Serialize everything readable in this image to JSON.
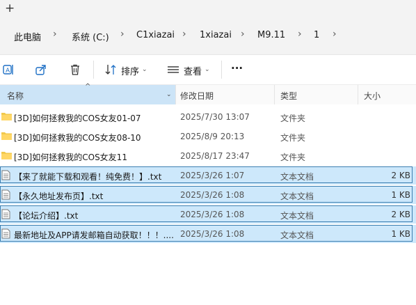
{
  "tabstrip": {
    "new_tab_glyph": "+"
  },
  "breadcrumb": [
    {
      "label": "此电脑"
    },
    {
      "label": "系统 (C:)"
    },
    {
      "label": "C1xiazai"
    },
    {
      "label": "1xiazai"
    },
    {
      "label": "M9.11"
    },
    {
      "label": "1"
    }
  ],
  "toolbar": {
    "sort_label": "排序",
    "view_label": "查看",
    "more_glyph": "···"
  },
  "columns": {
    "name": "名称",
    "date": "修改日期",
    "type": "类型",
    "size": "大小"
  },
  "files": [
    {
      "name": "[3D]如何拯救我的COS女友01-07",
      "date": "2025/7/30 13:07",
      "type": "文件夹",
      "size": "",
      "kind": "folder",
      "selected": false
    },
    {
      "name": "[3D]如何拯救我的COS女友08-10",
      "date": "2025/8/9 20:13",
      "type": "文件夹",
      "size": "",
      "kind": "folder",
      "selected": false
    },
    {
      "name": "[3D]如何拯救我的COS女友11",
      "date": "2025/8/17 23:47",
      "type": "文件夹",
      "size": "",
      "kind": "folder",
      "selected": false
    },
    {
      "name": "【来了就能下载和观看！纯免费！】.txt",
      "date": "2025/3/26 1:07",
      "type": "文本文档",
      "size": "2 KB",
      "kind": "txt",
      "selected": true
    },
    {
      "name": "【永久地址发布页】.txt",
      "date": "2025/3/26 1:08",
      "type": "文本文档",
      "size": "1 KB",
      "kind": "txt",
      "selected": true
    },
    {
      "name": "【论坛介绍】.txt",
      "date": "2025/3/26 1:08",
      "type": "文本文档",
      "size": "2 KB",
      "kind": "txt",
      "selected": true
    },
    {
      "name": "最新地址及APP请发邮箱自动获取！！！....",
      "date": "2025/3/26 1:08",
      "type": "文本文档",
      "size": "1 KB",
      "kind": "txt",
      "selected": true
    }
  ],
  "colors": {
    "selection": "#cde8fb",
    "selection_border": "#3c7fb1",
    "folder": "#f2c94c"
  }
}
